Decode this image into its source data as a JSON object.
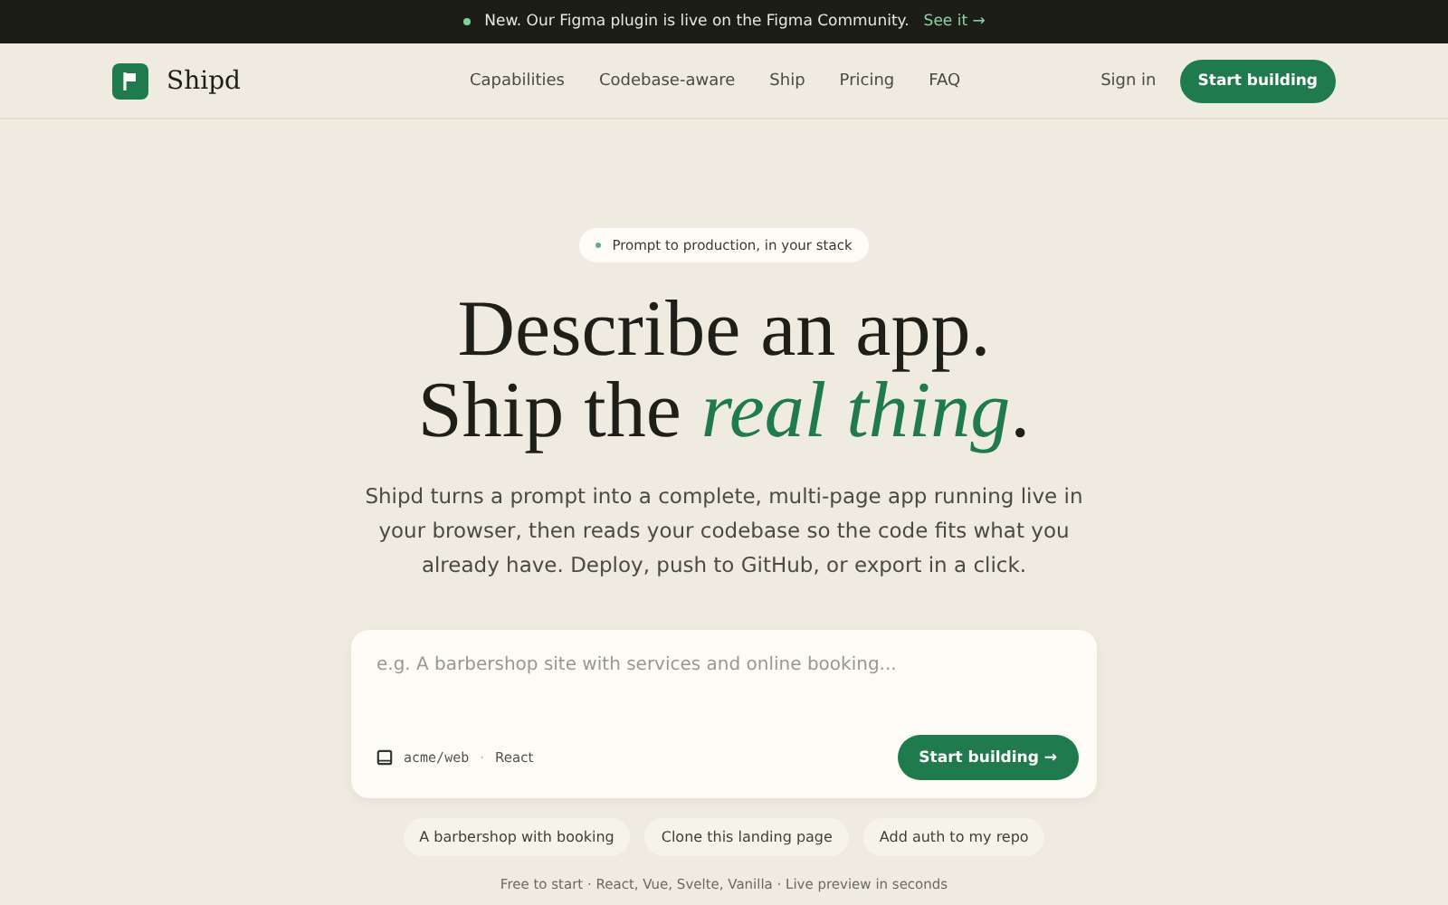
{
  "announcement": {
    "text": "New. Our Figma plugin is live on the Figma Community.",
    "link": "See it →"
  },
  "nav": {
    "brand": "Shipd",
    "links": [
      "Capabilities",
      "Codebase-aware",
      "Ship",
      "Pricing",
      "FAQ"
    ],
    "sign_in": "Sign in",
    "cta": "Start building"
  },
  "hero": {
    "badge": "Prompt to production, in your stack",
    "headline": [
      "Describe an app.",
      "Ship the *real thing*."
    ],
    "description": "Shipd turns a prompt into a complete, multi-page app running live in your browser, then reads your codebase so the code fits what you already have. Deploy, push to GitHub, or export in a click."
  },
  "prompt": {
    "placeholder": "e.g. A barbershop site with services and online booking...",
    "repo": "acme/web",
    "separator": "·",
    "framework": "React",
    "button": "Start building",
    "button_arrow": "→"
  },
  "suggestions": [
    "A barbershop with booking",
    "Clone this landing page",
    "Add auth to my repo"
  ],
  "footnote": "Free to start · React, Vue, Svelte, Vanilla · Live preview in seconds"
}
